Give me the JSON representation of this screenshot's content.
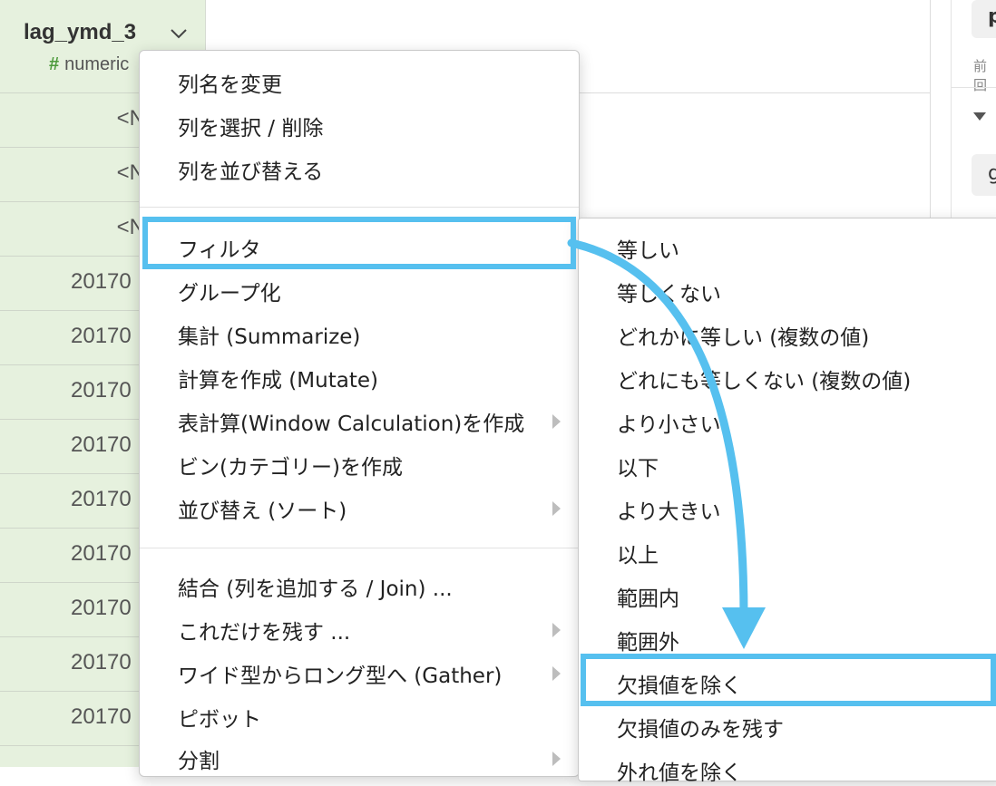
{
  "column": {
    "name": "lag_ymd_3",
    "type_symbol": "#",
    "type_label": "numeric"
  },
  "cells": [
    "<N",
    "<N",
    "<N",
    "20170",
    "20170",
    "20170",
    "20170",
    "20170",
    "20170",
    "20170",
    "20170",
    "20170"
  ],
  "right_panel": {
    "top_label": "p",
    "small_label": "前回",
    "box_label": "g"
  },
  "main_menu": {
    "group1": [
      "列名を変更",
      "列を選択 / 削除",
      "列を並び替える"
    ],
    "group2": [
      "フィルタ",
      "グループ化",
      "集計 (Summarize)",
      "計算を作成 (Mutate)",
      "表計算(Window Calculation)を作成",
      "ビン(カテゴリー)を作成",
      "並び替え (ソート)"
    ],
    "group3": [
      "結合 (列を追加する / Join) ...",
      "これだけを残す ...",
      "ワイド型からロング型へ (Gather)",
      "ピボット",
      "分割"
    ]
  },
  "filter_submenu": [
    "等しい",
    "等しくない",
    "どれかに等しい (複数の値)",
    "どれにも等しくない (複数の値)",
    "より小さい",
    "以下",
    "より大きい",
    "以上",
    "範囲内",
    "範囲外",
    "欠損値を除く",
    "欠損値のみを残す",
    "外れ値を除く"
  ],
  "colors": {
    "highlight": "#56c0ef",
    "column_bg": "#e6f1de",
    "numeric_hash": "#4c9a3b"
  },
  "icons": [
    "chevron-down-icon",
    "submenu-arrow-icon",
    "collapse-triangle-icon",
    "annotation-arrow"
  ]
}
